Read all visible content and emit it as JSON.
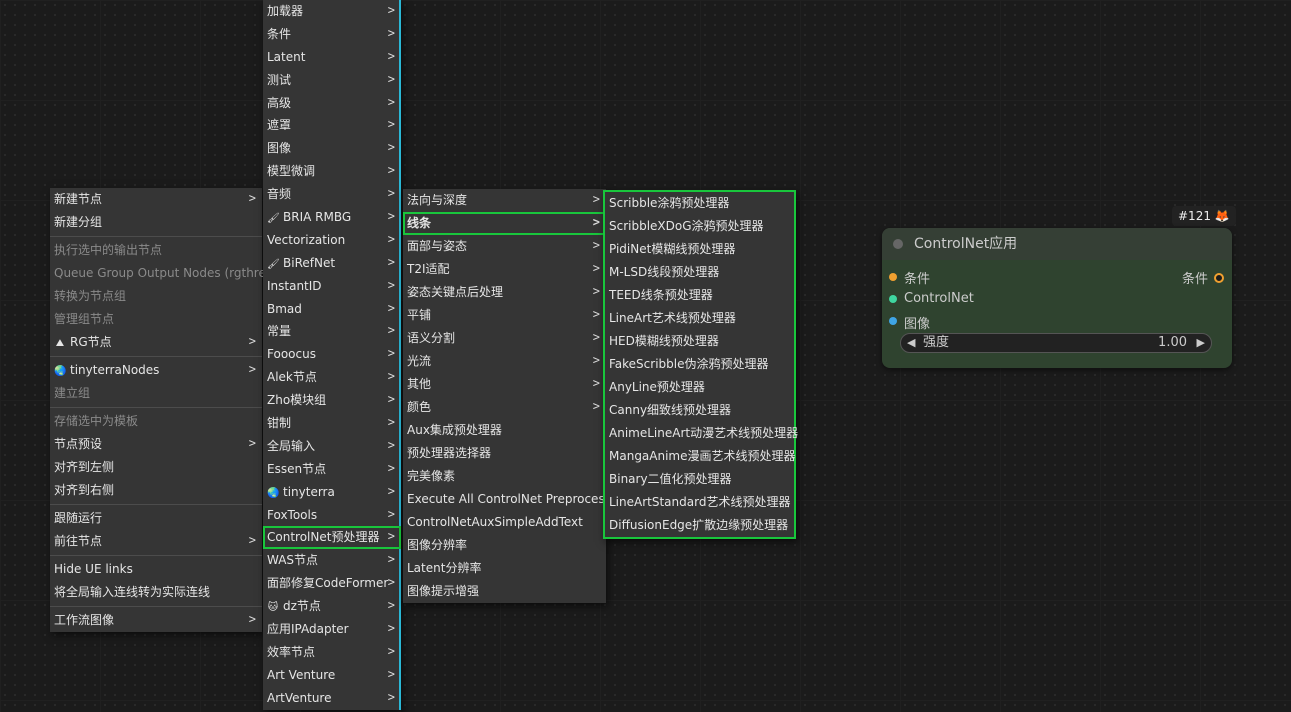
{
  "menu1": {
    "items": [
      {
        "label": "新建节点",
        "sub": true
      },
      {
        "label": "新建分组"
      },
      {
        "sep": true
      },
      {
        "label": "执行选中的输出节点",
        "disabled": true
      },
      {
        "label": "Queue Group Output Nodes (rgthree)",
        "disabled": true
      },
      {
        "label": "转换为节点组",
        "disabled": true
      },
      {
        "label": "管理组节点",
        "disabled": true
      },
      {
        "label": "RG节点",
        "sub": true,
        "icon": "rg-icon"
      },
      {
        "sep": true
      },
      {
        "label": "tinyterraNodes",
        "sub": true,
        "icon": "globe-icon"
      },
      {
        "label": "建立组",
        "disabled": true
      },
      {
        "sep": true
      },
      {
        "label": "存储选中为模板",
        "disabled": true
      },
      {
        "label": "节点预设",
        "sub": true
      },
      {
        "label": "对齐到左侧"
      },
      {
        "label": "对齐到右侧"
      },
      {
        "sep": true
      },
      {
        "label": "跟随运行"
      },
      {
        "label": "前往节点",
        "sub": true
      },
      {
        "sep": true
      },
      {
        "label": "Hide UE links"
      },
      {
        "label": "将全局输入连线转为实际连线"
      },
      {
        "sep": true
      },
      {
        "label": "工作流图像",
        "sub": true
      }
    ]
  },
  "menu2": {
    "items": [
      {
        "label": "加载器"
      },
      {
        "label": "条件"
      },
      {
        "label": "Latent"
      },
      {
        "label": "测试"
      },
      {
        "label": "高级"
      },
      {
        "label": "遮罩"
      },
      {
        "label": "图像"
      },
      {
        "label": "模型微调"
      },
      {
        "label": "音频"
      },
      {
        "label": "BRIA RMBG",
        "icon": "brush-icon"
      },
      {
        "label": "Vectorization"
      },
      {
        "label": "BiRefNet",
        "icon": "brush-icon"
      },
      {
        "label": "InstantID"
      },
      {
        "label": "Bmad"
      },
      {
        "label": "常量"
      },
      {
        "label": "Fooocus"
      },
      {
        "label": "Alek节点"
      },
      {
        "label": "Zho模块组"
      },
      {
        "label": "钳制"
      },
      {
        "label": "全局输入"
      },
      {
        "label": "Essen节点"
      },
      {
        "label": "tinyterra",
        "icon": "globe-icon"
      },
      {
        "label": "FoxTools"
      },
      {
        "label": "ControlNet预处理器",
        "highlight": true
      },
      {
        "label": "WAS节点"
      },
      {
        "label": "面部修复CodeFormer"
      },
      {
        "label": "dz节点",
        "icon": "cat-icon"
      },
      {
        "label": "应用IPAdapter"
      },
      {
        "label": "效率节点"
      },
      {
        "label": "Art Venture"
      },
      {
        "label": "ArtVenture"
      }
    ]
  },
  "menu3": {
    "items": [
      {
        "label": "法向与深度",
        "sub": true
      },
      {
        "label": "线条",
        "sub": true,
        "highlight": true,
        "bold": true
      },
      {
        "label": "面部与姿态",
        "sub": true
      },
      {
        "label": "T2I适配",
        "sub": true
      },
      {
        "label": "姿态关键点后处理",
        "sub": true
      },
      {
        "label": "平铺",
        "sub": true
      },
      {
        "label": "语义分割",
        "sub": true
      },
      {
        "label": "光流",
        "sub": true
      },
      {
        "label": "其他",
        "sub": true
      },
      {
        "label": "颜色",
        "sub": true
      },
      {
        "label": "Aux集成预处理器"
      },
      {
        "label": "预处理器选择器"
      },
      {
        "label": "完美像素"
      },
      {
        "label": "Execute All ControlNet Preprocessors"
      },
      {
        "label": "ControlNetAuxSimpleAddText"
      },
      {
        "label": "图像分辨率"
      },
      {
        "label": "Latent分辨率"
      },
      {
        "label": "图像提示增强"
      }
    ]
  },
  "menu4": {
    "items": [
      {
        "label": "Scribble涂鸦预处理器"
      },
      {
        "label": "ScribbleXDoG涂鸦预处理器"
      },
      {
        "label": "PidiNet模糊线预处理器"
      },
      {
        "label": "M-LSD线段预处理器"
      },
      {
        "label": "TEED线条预处理器"
      },
      {
        "label": "LineArt艺术线预处理器"
      },
      {
        "label": "HED模糊线预处理器"
      },
      {
        "label": "FakeScribble伪涂鸦预处理器"
      },
      {
        "label": "AnyLine预处理器"
      },
      {
        "label": "Canny细致线预处理器"
      },
      {
        "label": "AnimeLineArt动漫艺术线预处理器"
      },
      {
        "label": "MangaAnime漫画艺术线预处理器"
      },
      {
        "label": "Binary二值化预处理器"
      },
      {
        "label": "LineArtStandard艺术线预处理器"
      },
      {
        "label": "DiffusionEdge扩散边缘预处理器"
      }
    ]
  },
  "node": {
    "badge": "#121",
    "badge_icon": "fox-icon",
    "title": "ControlNet应用",
    "inputs": [
      {
        "label": "条件",
        "color": "#f0a030"
      },
      {
        "label": "ControlNet",
        "color": "#3fd6a0"
      },
      {
        "label": "图像",
        "color": "#3fa5e6"
      }
    ],
    "output": {
      "label": "条件",
      "color": "#f0a030"
    },
    "widget": {
      "label": "强度",
      "value": "1.00"
    }
  },
  "colors": {
    "highlight": "#19c63c",
    "accent": "#2bb8d6",
    "menu_bg": "#353535"
  }
}
